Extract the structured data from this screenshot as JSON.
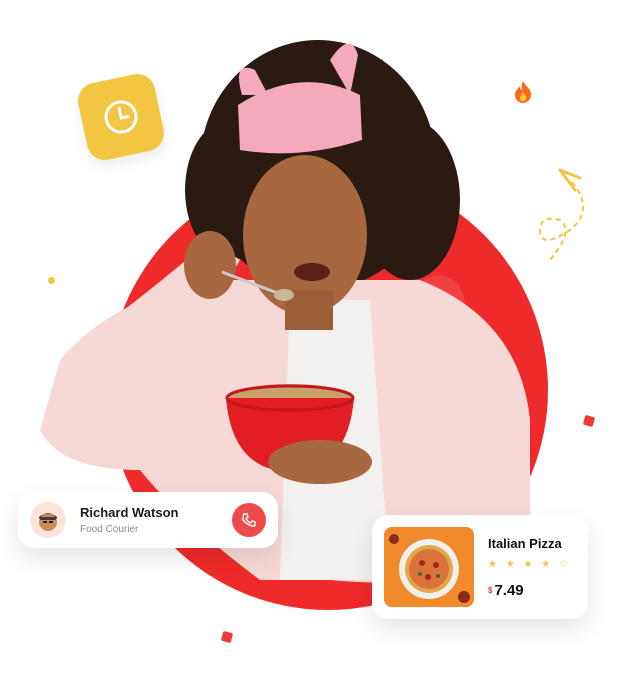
{
  "courier": {
    "name": "Richard Watson",
    "role": "Food Courier"
  },
  "product": {
    "name": "Italian Pizza",
    "rating": 4,
    "rating_max": 5,
    "stars_text": "★ ★ ★ ★ ☆",
    "currency": "$",
    "price": "7.49"
  },
  "icons": {
    "clock": "clock-icon",
    "fire": "fire-icon",
    "phone": "phone-icon",
    "paper_plane": "paper-plane-icon"
  },
  "colors": {
    "accent": "#ef2a2a",
    "tile": "#f2c542",
    "call": "#ef4a4a",
    "star": "#f2c542"
  }
}
